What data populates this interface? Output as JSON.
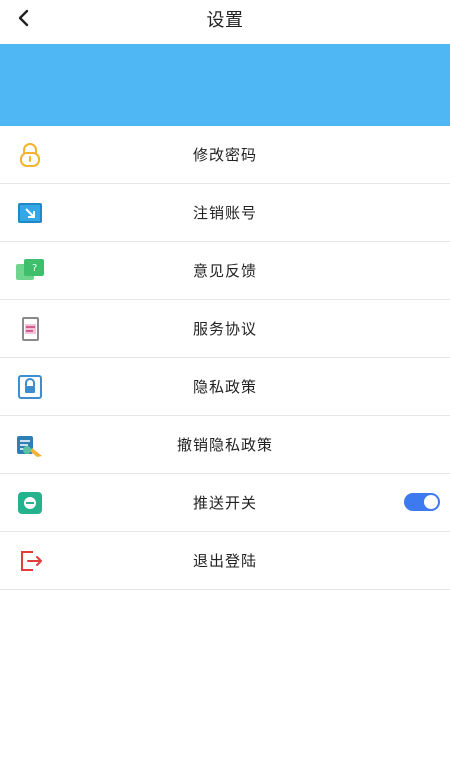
{
  "header": {
    "title": "设置",
    "back_icon": "chevron-left-icon"
  },
  "banner": {
    "color": "#4fb7f3"
  },
  "menu": {
    "items": [
      {
        "label": "修改密码",
        "icon": "lock-icon",
        "icon_color": "#f1b42a"
      },
      {
        "label": "注销账号",
        "icon": "account-cancel-icon",
        "icon_color": "#1e88c9"
      },
      {
        "label": "意见反馈",
        "icon": "feedback-icon",
        "icon_color": "#3fbf6b"
      },
      {
        "label": "服务协议",
        "icon": "document-icon",
        "icon_color": "#c43b7a"
      },
      {
        "label": "隐私政策",
        "icon": "privacy-icon",
        "icon_color": "#3b8fd1"
      },
      {
        "label": "撤销隐私政策",
        "icon": "revoke-privacy-icon",
        "icon_color": "#2f7fb7"
      },
      {
        "label": "推送开关",
        "icon": "notification-icon",
        "icon_color": "#25b38e"
      },
      {
        "label": "退出登陆",
        "icon": "logout-icon",
        "icon_color": "#e53b3b"
      }
    ]
  },
  "push_toggle": {
    "enabled": true,
    "color": "#3d7af0"
  }
}
